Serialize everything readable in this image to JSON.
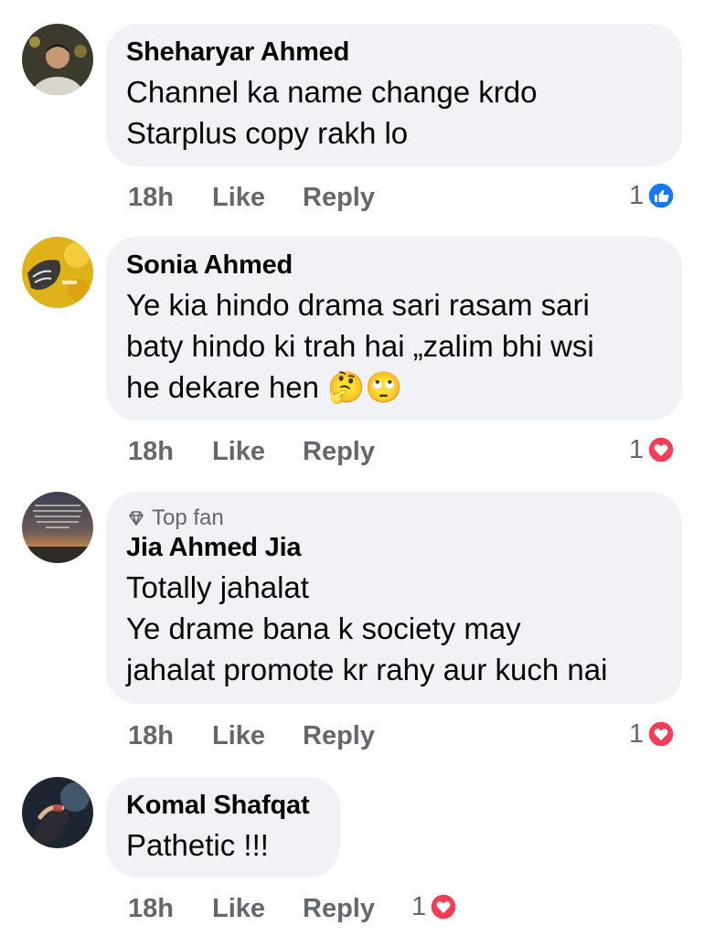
{
  "comments": [
    {
      "author": "Sheharyar Ahmed",
      "text": "Channel ka name change krdo\nStarplus copy rakh lo",
      "time": "18h",
      "like": "Like",
      "reply": "Reply",
      "reaction_count": "1",
      "reaction_icon": "like-icon",
      "reaction_color": "#1877f2"
    },
    {
      "author": "Sonia Ahmed",
      "text": "Ye kia hindo drama sari rasam sari\nbaty hindo ki trah hai „zalim bhi wsi\nhe dekare hen",
      "emoji": "🤔🙄",
      "time": "18h",
      "like": "Like",
      "reply": "Reply",
      "reaction_count": "1",
      "reaction_icon": "love-icon",
      "reaction_color": "#f33e58"
    },
    {
      "badge": "Top fan",
      "author": "Jia Ahmed Jia",
      "text": "Totally jahalat\nYe drame bana k society may\njahalat promote kr rahy aur kuch nai",
      "time": "18h",
      "like": "Like",
      "reply": "Reply",
      "reaction_count": "1",
      "reaction_icon": "love-icon",
      "reaction_color": "#f33e58"
    },
    {
      "author": "Komal Shafqat",
      "text": "Pathetic !!!",
      "time": "18h",
      "like": "Like",
      "reply": "Reply",
      "reaction_count": "1",
      "reaction_icon": "love-icon",
      "reaction_color": "#f33e58"
    }
  ],
  "colors": {
    "bubble_bg": "#f0f2f5",
    "secondary_text": "#65676b",
    "primary_text": "#050505"
  }
}
